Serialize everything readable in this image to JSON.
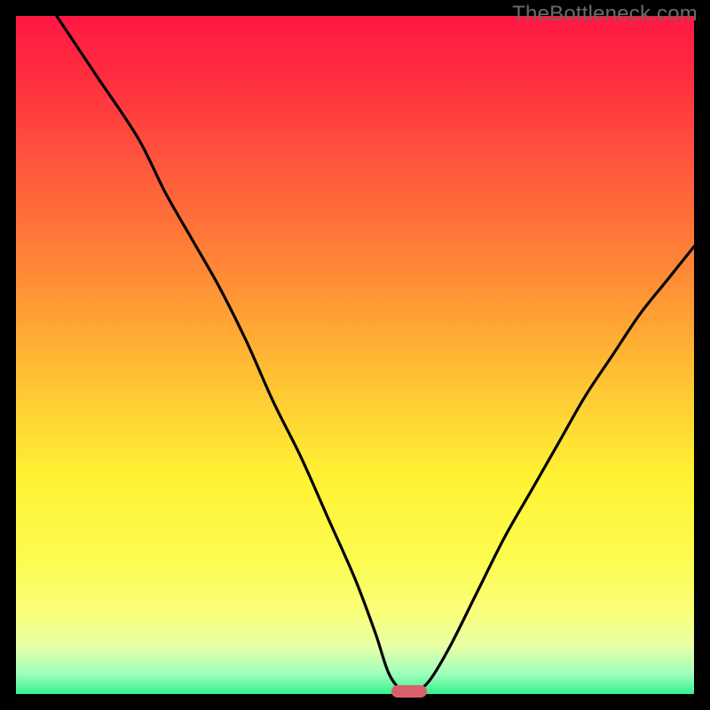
{
  "watermark": "TheBottleneck.com",
  "chart_data": {
    "type": "line",
    "title": "",
    "xlabel": "",
    "ylabel": "",
    "xlim": [
      0,
      100
    ],
    "ylim": [
      0,
      100
    ],
    "background_gradient": {
      "top": "#ff1844",
      "middle": "#ffd134",
      "bottom": "#35f08e"
    },
    "marker": {
      "x": 58,
      "y": 0,
      "color": "#d9606a"
    },
    "series": [
      {
        "name": "bottleneck-curve",
        "points": [
          {
            "x": 6,
            "y": 100
          },
          {
            "x": 12,
            "y": 91
          },
          {
            "x": 18,
            "y": 82
          },
          {
            "x": 22,
            "y": 74
          },
          {
            "x": 26,
            "y": 67
          },
          {
            "x": 30,
            "y": 60
          },
          {
            "x": 34,
            "y": 52
          },
          {
            "x": 38,
            "y": 43
          },
          {
            "x": 42,
            "y": 35
          },
          {
            "x": 46,
            "y": 26
          },
          {
            "x": 50,
            "y": 17
          },
          {
            "x": 53,
            "y": 9
          },
          {
            "x": 55,
            "y": 3
          },
          {
            "x": 57,
            "y": 0.5
          },
          {
            "x": 59,
            "y": 0.5
          },
          {
            "x": 61,
            "y": 2
          },
          {
            "x": 64,
            "y": 7
          },
          {
            "x": 68,
            "y": 15
          },
          {
            "x": 72,
            "y": 23
          },
          {
            "x": 76,
            "y": 30
          },
          {
            "x": 80,
            "y": 37
          },
          {
            "x": 84,
            "y": 44
          },
          {
            "x": 88,
            "y": 50
          },
          {
            "x": 92,
            "y": 56
          },
          {
            "x": 96,
            "y": 61
          },
          {
            "x": 100,
            "y": 66
          }
        ]
      }
    ]
  }
}
